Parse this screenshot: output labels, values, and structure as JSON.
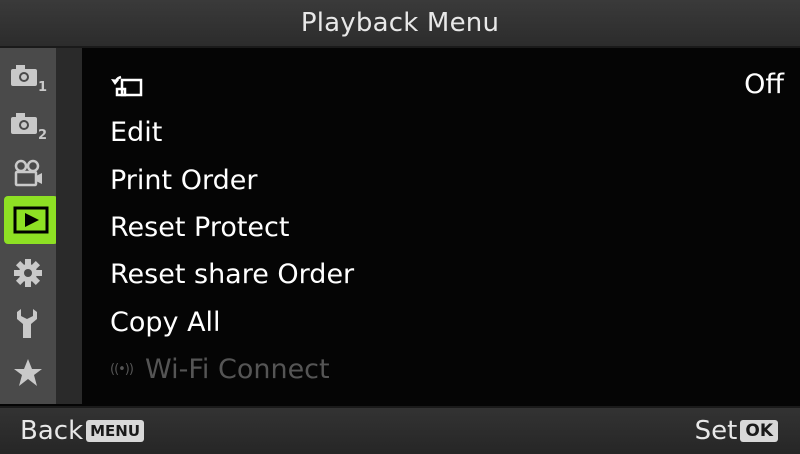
{
  "title": "Playback Menu",
  "sidebar": {
    "tabs": [
      {
        "name": "shooting-menu-1",
        "icon": "camera-1-icon",
        "active": false
      },
      {
        "name": "shooting-menu-2",
        "icon": "camera-2-icon",
        "active": false
      },
      {
        "name": "video-menu",
        "icon": "video-camera-icon",
        "active": false
      },
      {
        "name": "playback-menu",
        "icon": "play-icon",
        "active": true
      },
      {
        "name": "custom-menu",
        "icon": "gear-icon",
        "active": false
      },
      {
        "name": "setup-menu",
        "icon": "wrench-icon",
        "active": false
      },
      {
        "name": "my-menu",
        "icon": "star-icon",
        "active": false
      }
    ],
    "active_color": "#8ee024"
  },
  "menu": {
    "items": [
      {
        "label": "",
        "icon": "rotate-icon",
        "value": "Off",
        "enabled": true
      },
      {
        "label": "Edit",
        "value": "",
        "enabled": true
      },
      {
        "label": "Print Order",
        "value": "",
        "enabled": true
      },
      {
        "label": "Reset Protect",
        "value": "",
        "enabled": true
      },
      {
        "label": "Reset share Order",
        "value": "",
        "enabled": true
      },
      {
        "label": "Copy All",
        "value": "",
        "enabled": true
      },
      {
        "label": "Wi-Fi Connect",
        "icon": "wifi-icon",
        "value": "",
        "enabled": false
      }
    ]
  },
  "footer": {
    "back_label": "Back",
    "back_key": "MENU",
    "set_label": "Set",
    "set_key": "OK"
  }
}
